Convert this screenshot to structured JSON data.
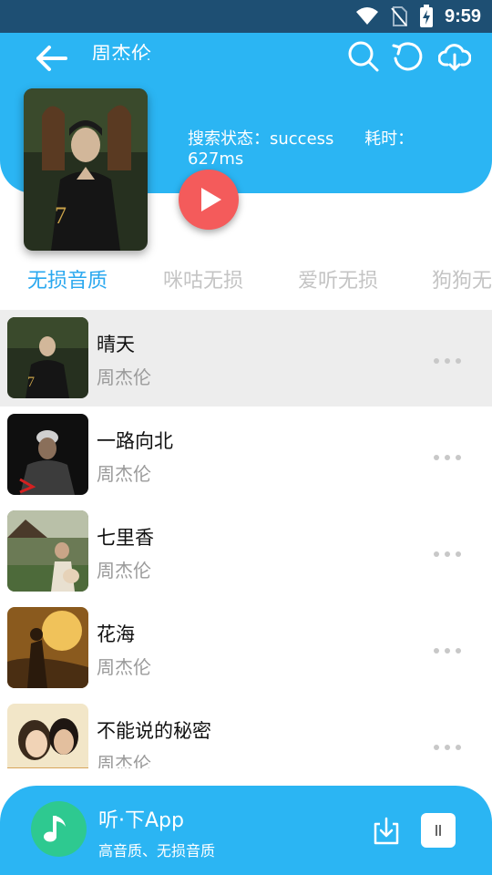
{
  "status_bar": {
    "time": "9:59"
  },
  "header": {
    "title": "周杰伦",
    "search_status_label": "搜索状态：",
    "search_status_value": "success",
    "elapsed_label": "耗时：",
    "elapsed_value": "627ms"
  },
  "tabs": [
    {
      "label": "无损音质",
      "active": true
    },
    {
      "label": "咪咕无损",
      "active": false
    },
    {
      "label": "爱听无损",
      "active": false
    },
    {
      "label": "狗狗无",
      "active": false
    }
  ],
  "songs": [
    {
      "title": "晴天",
      "artist": "周杰伦"
    },
    {
      "title": "一路向北",
      "artist": "周杰伦"
    },
    {
      "title": "七里香",
      "artist": "周杰伦"
    },
    {
      "title": "花海",
      "artist": "周杰伦"
    },
    {
      "title": "不能说的秘密",
      "artist": "周杰伦"
    }
  ],
  "bottom_bar": {
    "app_name": "听·下App",
    "app_desc": "高音质、无损音质"
  },
  "colors": {
    "header_bg": "#2bb5f3",
    "statusbar_bg": "#1e4f73",
    "active_tab": "#2aa8ef",
    "play_button": "#f45b5b",
    "app_logo": "#2ec990"
  }
}
